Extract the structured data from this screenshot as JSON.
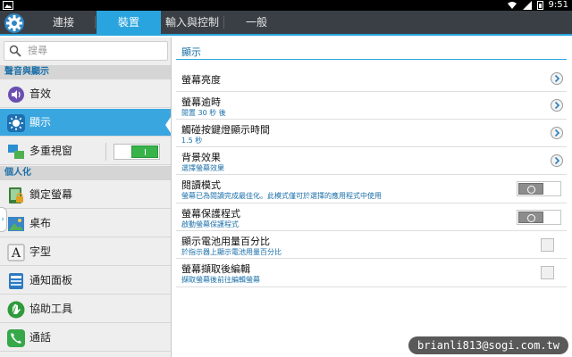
{
  "status_bar": {
    "time": "9:51",
    "icons": [
      "gallery-icon",
      "wifi-icon",
      "signal-icon",
      "battery-icon"
    ]
  },
  "app": {
    "icon": "settings-gear-icon"
  },
  "tabs": [
    {
      "label": "連接",
      "active": false
    },
    {
      "label": "裝置",
      "active": true
    },
    {
      "label": "輸入與控制",
      "active": false
    },
    {
      "label": "一般",
      "active": false
    }
  ],
  "sidebar": {
    "search_placeholder": "搜尋",
    "section_sound_display": "聲音與顯示",
    "section_personal": "個人化",
    "items": [
      {
        "label": "音效",
        "icon": "sound-icon"
      },
      {
        "label": "顯示",
        "icon": "display-icon",
        "selected": true
      },
      {
        "label": "多重視窗",
        "icon": "multi-window-icon",
        "switch_on": true
      },
      {
        "label": "鎖定螢幕",
        "icon": "lock-screen-icon"
      },
      {
        "label": "桌布",
        "icon": "wallpaper-icon"
      },
      {
        "label": "字型",
        "icon": "font-icon"
      },
      {
        "label": "通知面板",
        "icon": "notification-panel-icon"
      },
      {
        "label": "協助工具",
        "icon": "accessibility-icon"
      },
      {
        "label": "通話",
        "icon": "call-icon"
      }
    ]
  },
  "main": {
    "title": "顯示",
    "rows": [
      {
        "title": "螢幕亮度",
        "subtitle": "",
        "control": "chevron"
      },
      {
        "title": "螢幕逾時",
        "subtitle": "閒置 30 秒 後",
        "control": "chevron"
      },
      {
        "title": "觸碰按鍵燈顯示時間",
        "subtitle": "1.5 秒",
        "control": "chevron"
      },
      {
        "title": "背景效果",
        "subtitle": "選擇螢幕效果",
        "control": "chevron"
      },
      {
        "title": "閱讀模式",
        "subtitle": "螢幕已為閱讀完成最佳化。此模式僅可於選擇的應用程式中使用",
        "control": "toggle-off"
      },
      {
        "title": "螢幕保護程式",
        "subtitle": "啟動螢幕保護程式",
        "control": "toggle-off"
      },
      {
        "title": "顯示電池用量百分比",
        "subtitle": "於指示器上顯示電池用量百分比",
        "control": "checkbox"
      },
      {
        "title": "螢幕擷取後編輯",
        "subtitle": "擷取螢幕後前往編輯螢幕",
        "control": "checkbox"
      }
    ]
  },
  "watermark": "brianli813@sogi.com.tw",
  "colors": {
    "accent": "#2aa4de",
    "tabbar": "#3a3f45",
    "section_text": "#1b6fa8",
    "switch_on": "#37b34a"
  }
}
